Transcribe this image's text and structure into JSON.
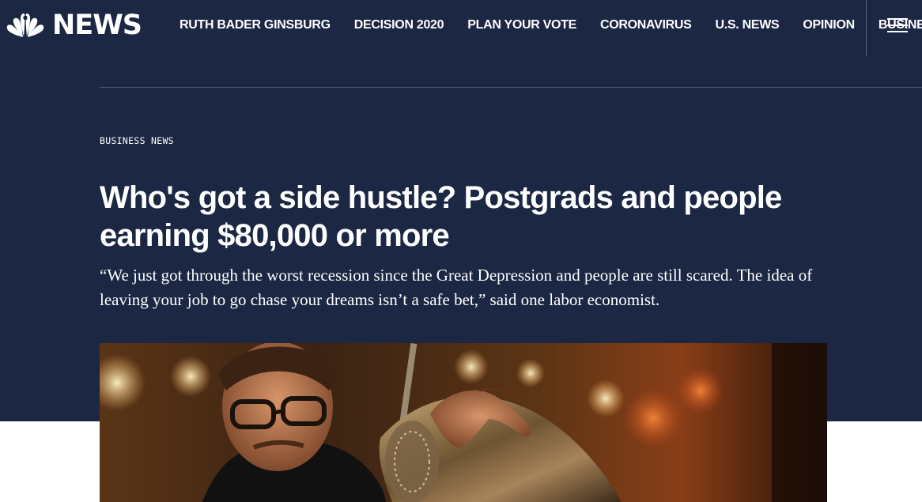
{
  "brand": {
    "wordmark": "NEWS",
    "logo_icon": "nbc-peacock-icon"
  },
  "nav": {
    "items": [
      {
        "label": "RUTH BADER GINSBURG"
      },
      {
        "label": "DECISION 2020"
      },
      {
        "label": "PLAN YOUR VOTE"
      },
      {
        "label": "CORONAVIRUS"
      },
      {
        "label": "U.S. NEWS"
      },
      {
        "label": "OPINION"
      },
      {
        "label": "BUSINESS"
      }
    ],
    "menu_icon": "hamburger-menu-icon"
  },
  "article": {
    "section": "BUSINESS NEWS",
    "headline": "Who's got a side hustle? Postgrads and people earning $80,000 or more",
    "dek": "“We just got through the worst recession since the Great Depression and people are still scared. The idea of leaving your job to go chase your dreams isn’t a safe bet,” said one labor economist.",
    "hero_image": "bartender-shaking-cocktail-photo"
  },
  "colors": {
    "hero_background": "#1b2743",
    "text": "#ffffff",
    "page_background": "#ffffff"
  }
}
